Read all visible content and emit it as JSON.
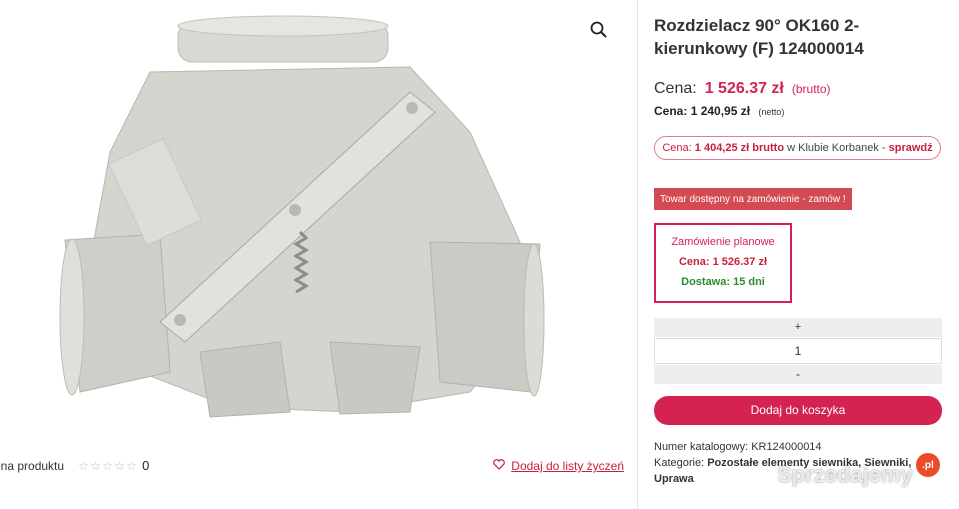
{
  "product": {
    "title": "Rozdzielacz 90° OK160 2-kierunkowy (F) 124000014"
  },
  "price": {
    "label": "Cena:",
    "value": "1 526.37 zł",
    "suffix": "(brutto)"
  },
  "net_price": {
    "label": "Cena:",
    "value": "1 240,95 zł",
    "suffix": "(netto)"
  },
  "club": {
    "label": "Cena:",
    "value": "1 404,25 zł brutto",
    "middle": "w Klubie Korbanek -",
    "link": "sprawdź"
  },
  "availability": {
    "text": "Towar dostępny na zamówienie - zamów !"
  },
  "plan": {
    "title": "Zamówienie planowe",
    "price": "Cena: 1 526.37 zł",
    "delivery": "Dostawa: 15 dni"
  },
  "quantity": {
    "plus": "+",
    "value": "1",
    "minus": "-"
  },
  "cart": {
    "button": "Dodaj do koszyka"
  },
  "meta": {
    "catalog": "Numer katalogowy: KR124000014",
    "category_label": "Kategorie:",
    "categories": "Pozostałe elementy siewnika, Siewniki, Uprawa"
  },
  "rating": {
    "label": "ena produktu",
    "count": "0",
    "stars": 0
  },
  "wishlist": {
    "label": "Dodaj do listy życzeń"
  },
  "watermark": {
    "text": "Sprzedajemy",
    "badge": ".pl"
  },
  "colors": {
    "accent": "#d42350",
    "availability_bg": "#d34a53",
    "delivery_green": "#2e8b2e"
  }
}
